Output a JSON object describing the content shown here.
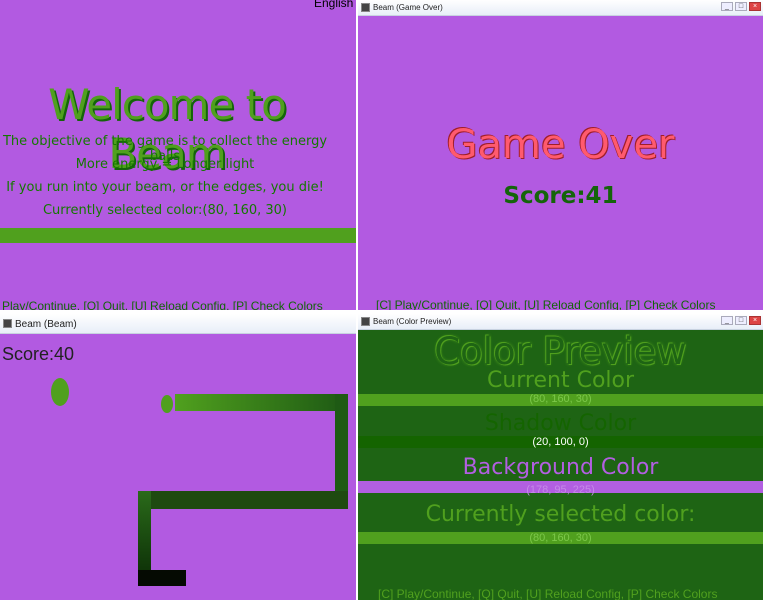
{
  "welcome": {
    "language": "English",
    "title": "Welcome to Beam",
    "line1": "The objective of the game is to collect the energy balls",
    "line2": "More energy = Longer light",
    "line3": "If you run into your beam, or the edges, you die!",
    "line4": "Currently selected color:(80, 160, 30)",
    "footer": "Play/Continue, [Q] Quit, [U] Reload Config, [P] Check Colors"
  },
  "gameover": {
    "window_title": "Beam (Game Over)",
    "title": "Game Over",
    "score": "Score:41",
    "footer": "[C] Play/Continue, [Q] Quit, [U] Reload Config, [P] Check Colors"
  },
  "gameplay": {
    "window_title": "Beam (Beam)",
    "score": "Score:40"
  },
  "preview": {
    "window_title": "Beam (Color Preview)",
    "title": "Color Preview",
    "current_label": "Current Color",
    "current_value": "(80, 160, 30)",
    "shadow_label": "Shadow Color",
    "shadow_value": "(20, 100, 0)",
    "background_label": "Background Color",
    "background_value": "(178, 95, 225)",
    "selected_label": "Currently selected color:",
    "selected_value": "(80, 160, 30)",
    "footer": "[C] Play/Continue, [Q] Quit, [U] Reload Config, [P] Check Colors"
  },
  "window_buttons": {
    "minimize": "_",
    "maximize": "□",
    "close": "×"
  },
  "icons": [
    "window-app-icon",
    "energy-ball-icon"
  ],
  "colors": {
    "current": "#50a01e",
    "shadow": "#146400",
    "background": "#b25fe1",
    "gameover": "#ff5a6e"
  }
}
